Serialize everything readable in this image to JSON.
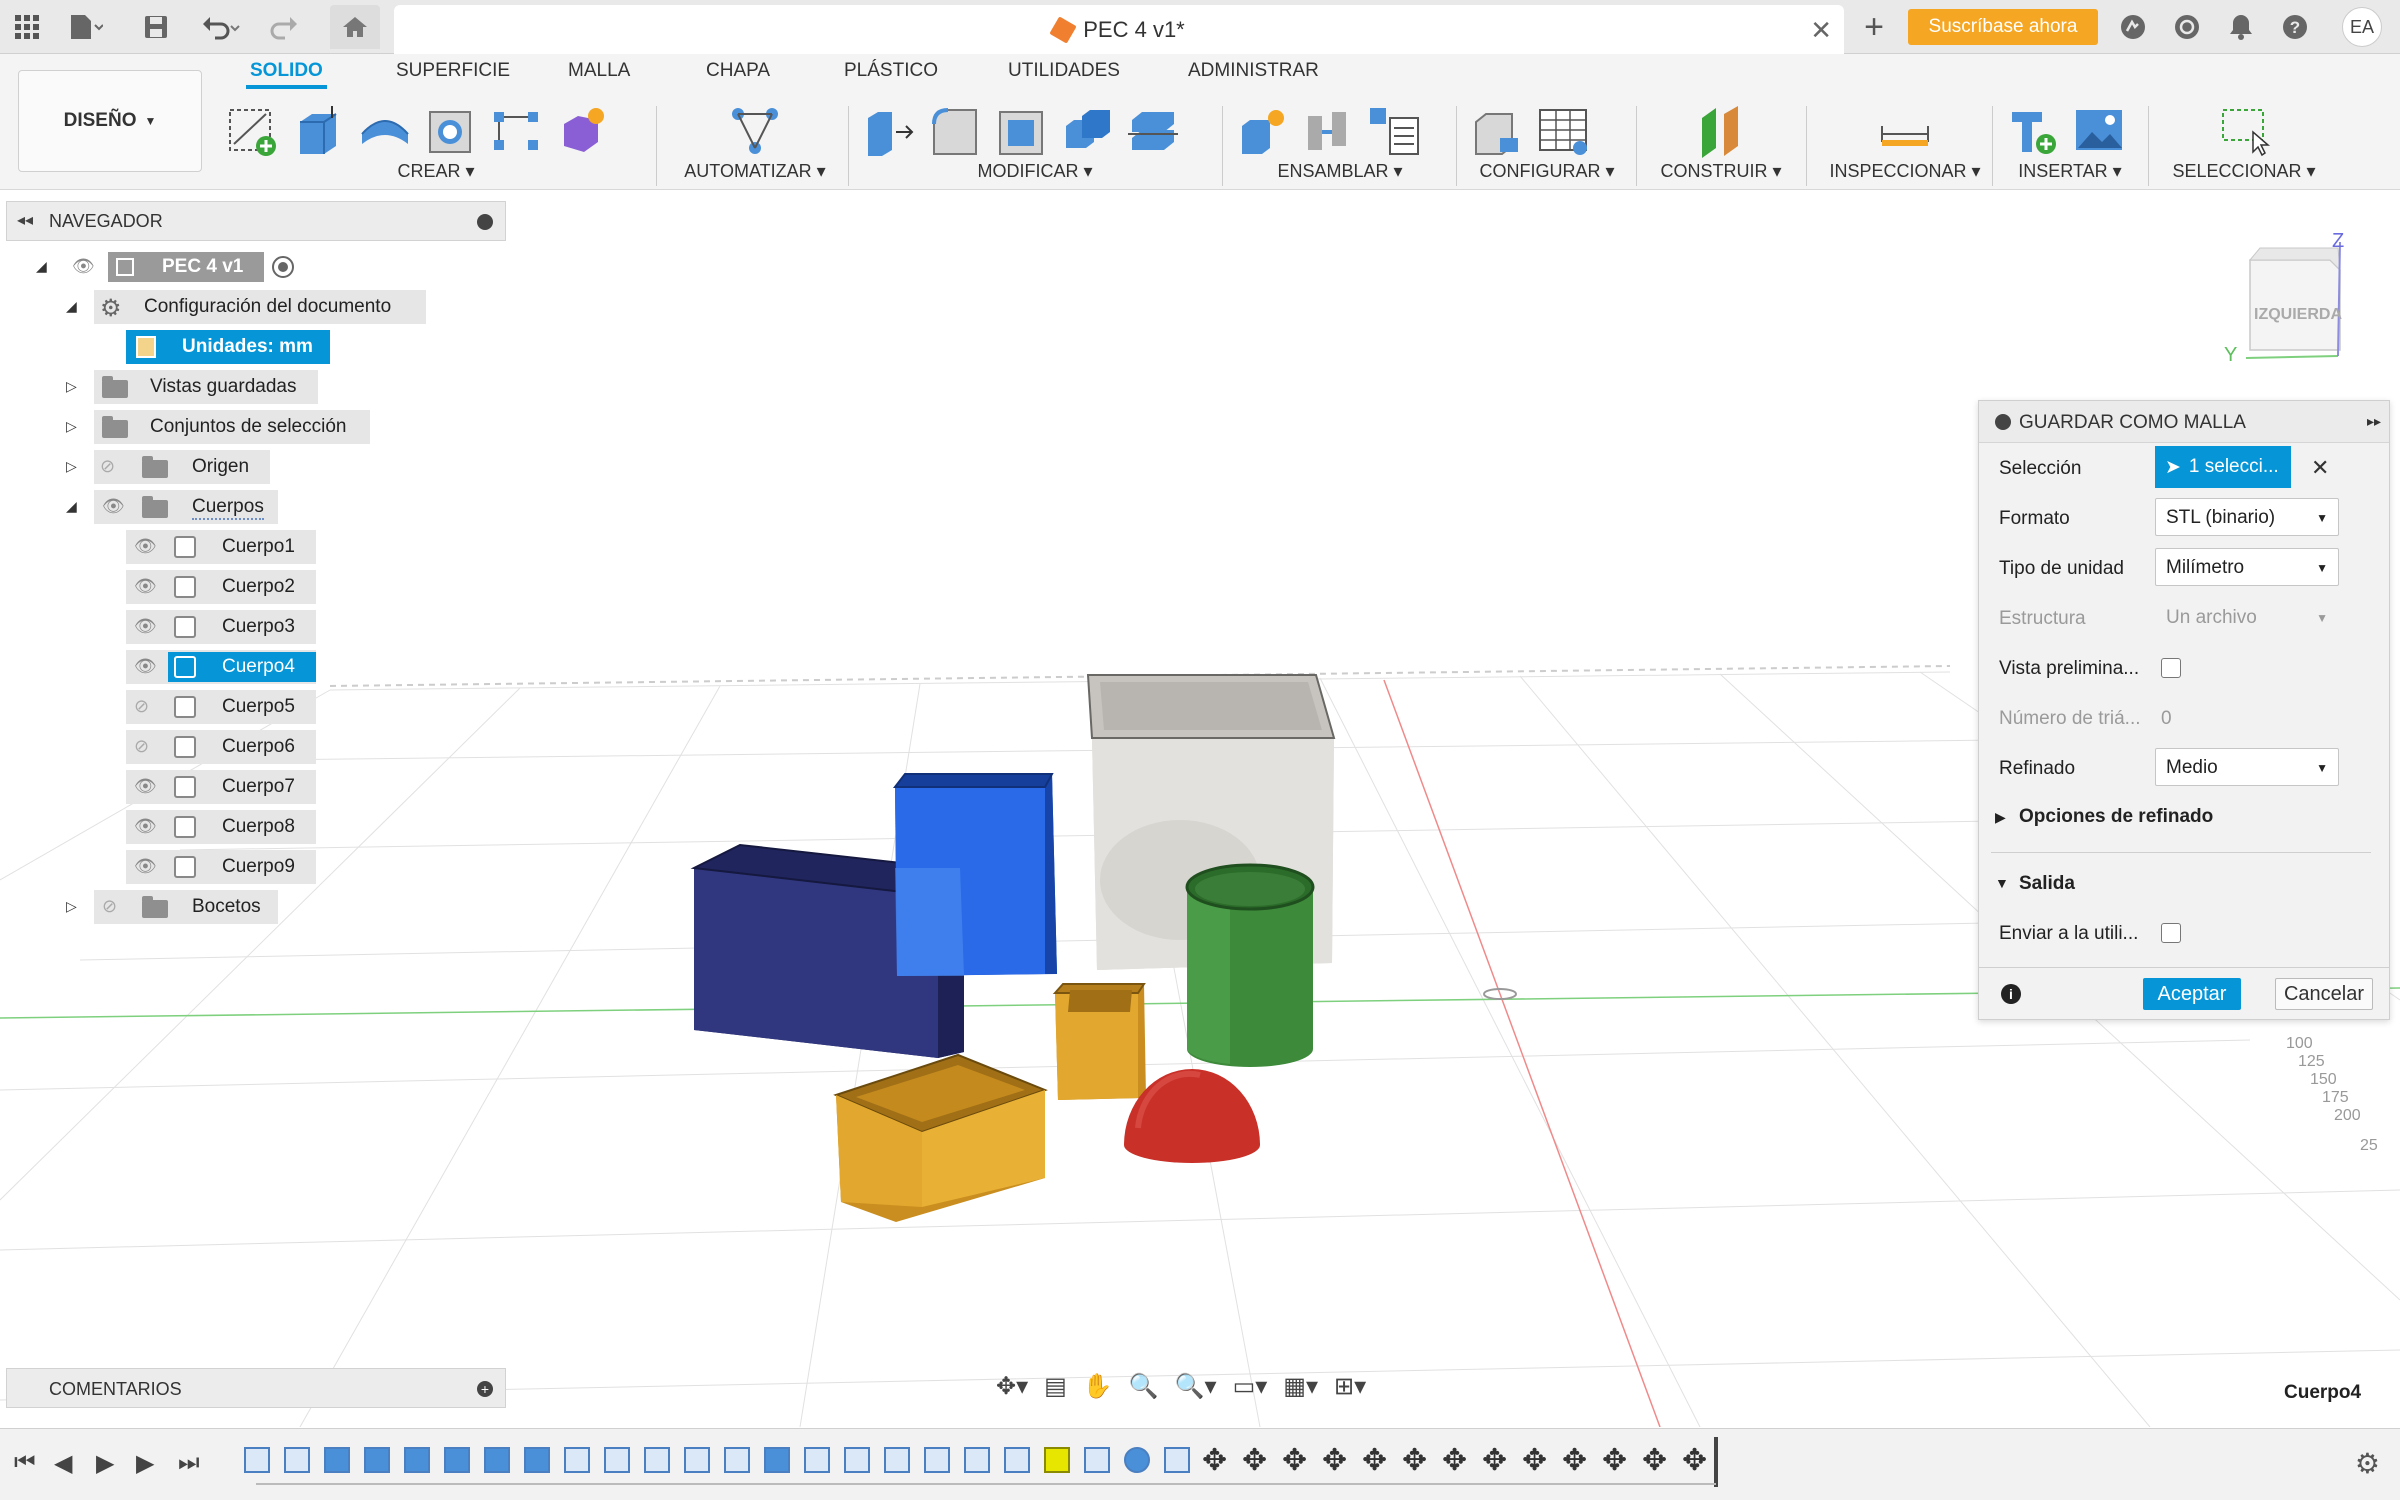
{
  "app": {
    "document_title": "PEC 4 v1*",
    "subscribe_label": "Suscríbase ahora",
    "user_initials": "EA"
  },
  "ribbon": {
    "workspace_label": "DISEÑO",
    "tabs": [
      "SOLIDO",
      "SUPERFICIE",
      "MALLA",
      "CHAPA",
      "PLÁSTICO",
      "UTILIDADES",
      "ADMINISTRAR"
    ],
    "active_tab": "SOLIDO",
    "groups": [
      "CREAR",
      "AUTOMATIZAR",
      "MODIFICAR",
      "ENSAMBLAR",
      "CONFIGURAR",
      "CONSTRUIR",
      "INSPECCIONAR",
      "INSERTAR",
      "SELECCIONAR"
    ]
  },
  "browser": {
    "title": "NAVEGADOR",
    "root": "PEC 4 v1",
    "doc_settings": "Configuración del documento",
    "units": "Unidades: mm",
    "saved_views": "Vistas guardadas",
    "selection_sets": "Conjuntos de selección",
    "origin": "Origen",
    "bodies_folder": "Cuerpos",
    "bodies": [
      "Cuerpo1",
      "Cuerpo2",
      "Cuerpo3",
      "Cuerpo4",
      "Cuerpo5",
      "Cuerpo6",
      "Cuerpo7",
      "Cuerpo8",
      "Cuerpo9"
    ],
    "sketches": "Bocetos"
  },
  "viewcube": {
    "face_label": "IZQUIERDA",
    "axis_z": "Z",
    "axis_y": "Y"
  },
  "dialog": {
    "title": "GUARDAR COMO MALLA",
    "selection_label": "Selección",
    "selection_value": "1 selecci...",
    "format_label": "Formato",
    "format_value": "STL (binario)",
    "unit_label": "Tipo de unidad",
    "unit_value": "Milímetro",
    "structure_label": "Estructura",
    "structure_value": "Un archivo",
    "preview_label": "Vista prelimina...",
    "triangles_label": "Número de triá...",
    "triangles_value": "0",
    "refine_label": "Refinado",
    "refine_value": "Medio",
    "refine_options_label": "Opciones de refinado",
    "output_label": "Salida",
    "send_label": "Enviar a la utili...",
    "ok_label": "Aceptar",
    "cancel_label": "Cancelar"
  },
  "footer": {
    "comments_title": "COMENTARIOS",
    "status_selection": "Cuerpo4"
  },
  "grid_labels": [
    "100",
    "125",
    "150",
    "175",
    "200",
    "25"
  ],
  "colors": {
    "accent": "#0696d7",
    "subscribe": "#f5a623",
    "body_navy": "#2e3478",
    "body_blue": "#1f5fd6",
    "body_white": "#d8d6d2",
    "body_green": "#3c8a3a",
    "body_yellow": "#e2a72e",
    "body_red": "#c83028"
  }
}
